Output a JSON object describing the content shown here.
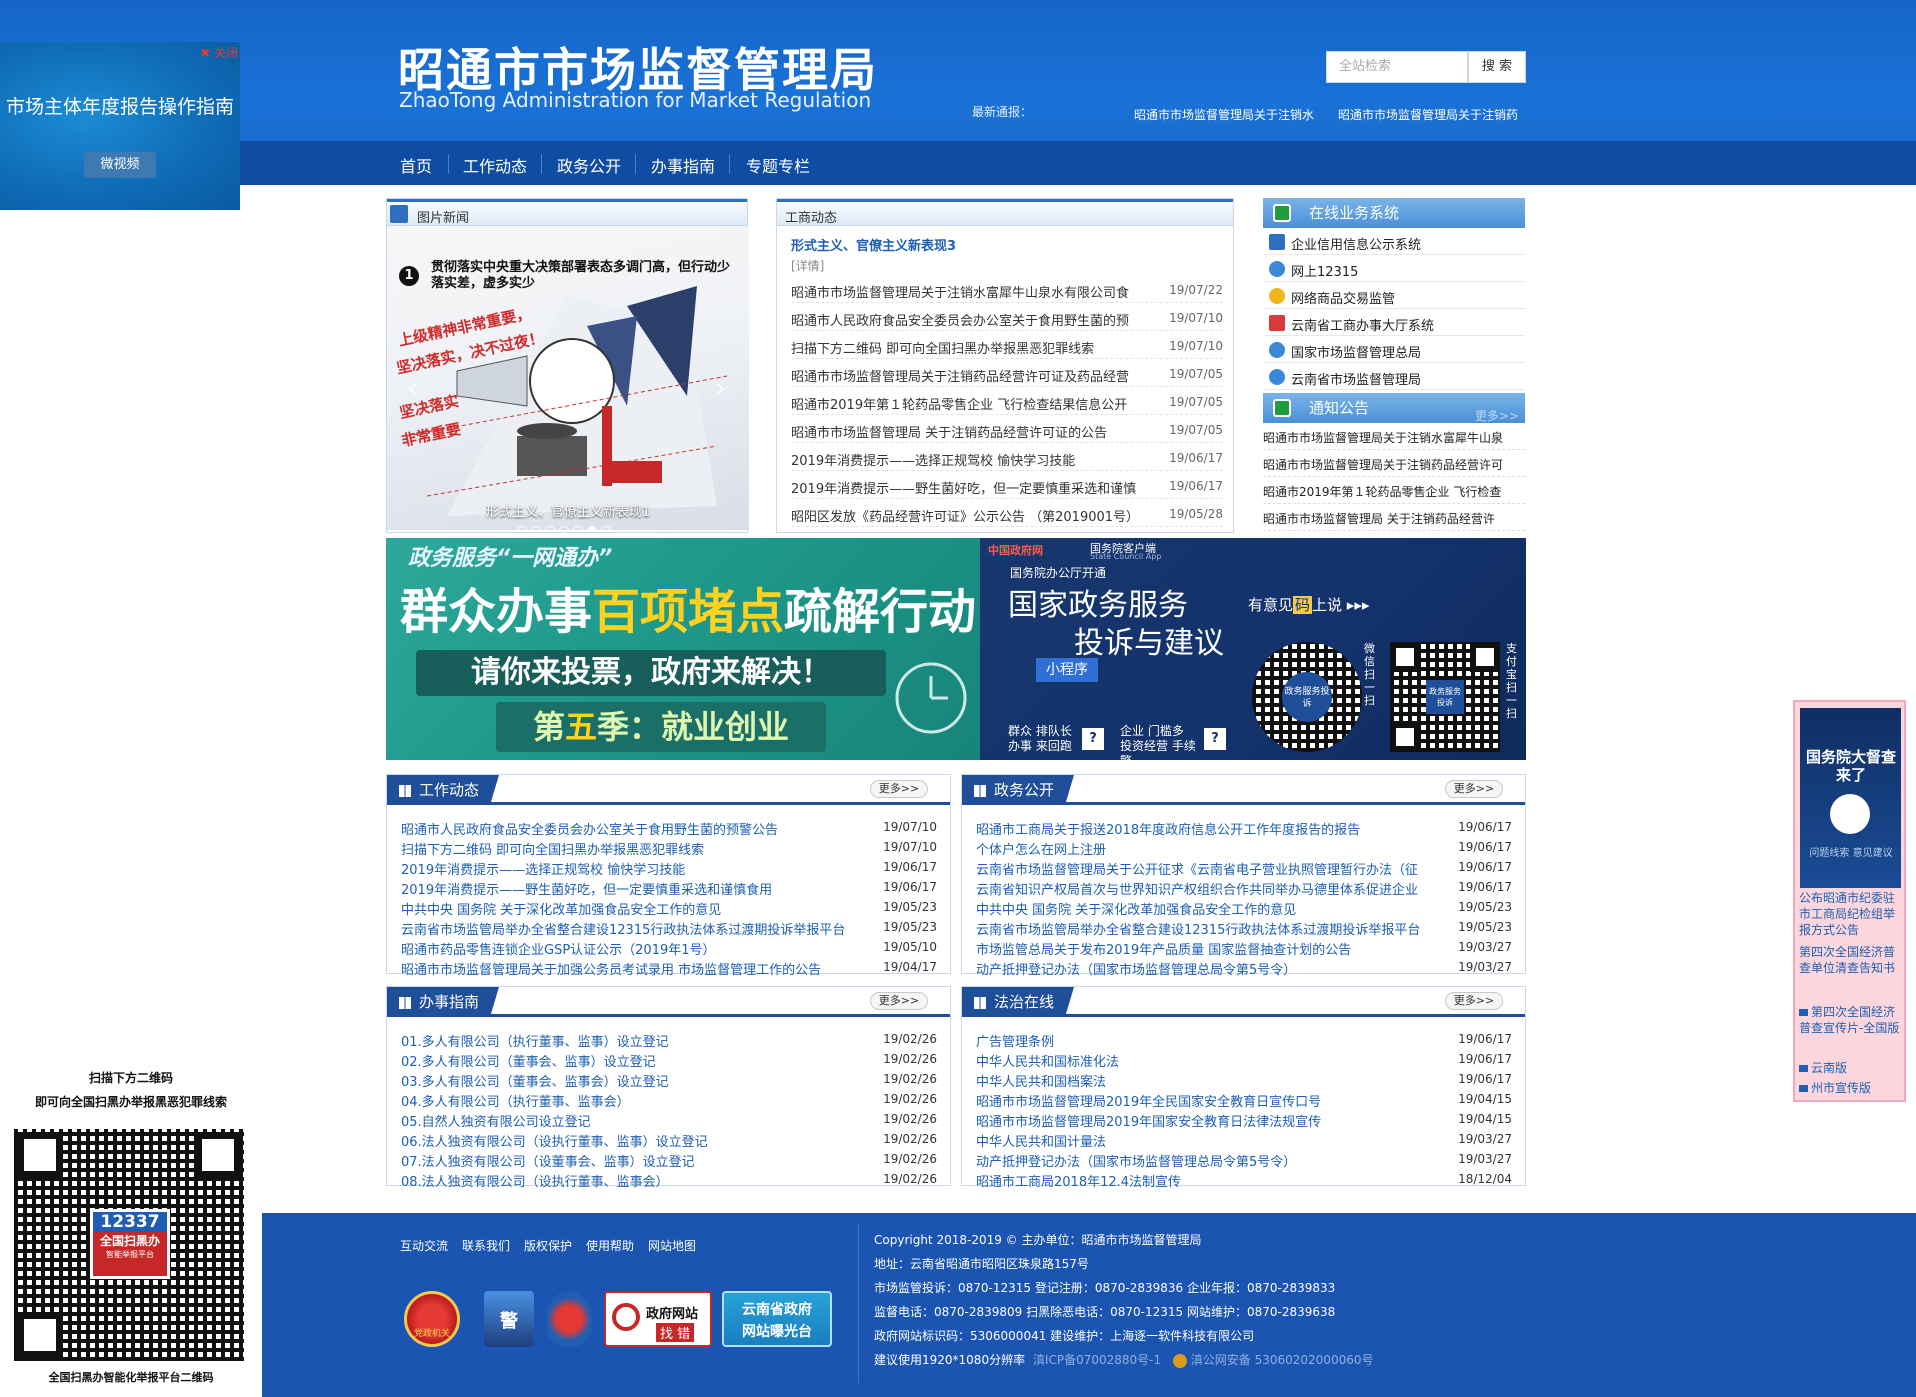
{
  "site": {
    "title": "昭通市市场监督管理局",
    "subtitle": "ZhaoTong Administration for Market Regulation"
  },
  "search": {
    "placeholder": "全站检索",
    "button": "搜 索"
  },
  "ticker": {
    "label": "最新通报：",
    "items": [
      "昭通市市场监督管理局关于注销水",
      "昭通市市场监督管理局关于注销药"
    ]
  },
  "nav": [
    "首页",
    "工作动态",
    "政务公开",
    "办事指南",
    "专题专栏"
  ],
  "float_left": {
    "close": "关闭",
    "title": "市场主体年度报告操作指南",
    "button": "微视频"
  },
  "photo_news": {
    "title": "图片新闻",
    "num": "1",
    "headline": "贯彻落实中央重大决策部署表态多调门高，但行动少落实差，虚多实少",
    "caption": "形式主义、官僚主义新表现1"
  },
  "business_news": {
    "title": "工商动态",
    "featured": "形式主义、官僚主义新表现3",
    "detail": "[详情]",
    "items": [
      {
        "title": "昭通市市场监督管理局关于注销水富犀牛山泉水有限公司食",
        "date": "19/07/22"
      },
      {
        "title": "昭通市人民政府食品安全委员会办公室关于食用野生菌的预",
        "date": "19/07/10"
      },
      {
        "title": "扫描下方二维码 即可向全国扫黑办举报黑恶犯罪线索",
        "date": "19/07/10"
      },
      {
        "title": "昭通市市场监督管理局关于注销药品经营许可证及药品经营",
        "date": "19/07/05"
      },
      {
        "title": "昭通市2019年第１轮药品零售企业 飞行检查结果信息公开",
        "date": "19/07/05"
      },
      {
        "title": "昭通市市场监督管理局 关于注销药品经营许可证的公告",
        "date": "19/07/05"
      },
      {
        "title": "2019年消费提示——选择正规驾校 愉快学习技能",
        "date": "19/06/17"
      },
      {
        "title": "2019年消费提示——野生菌好吃，但一定要慎重采选和谨慎",
        "date": "19/06/17"
      },
      {
        "title": "昭阳区发放《药品经营许可证》公示公告 （第2019001号）",
        "date": "19/05/28"
      }
    ]
  },
  "online_systems": {
    "title": "在线业务系统",
    "items": [
      "企业信用信息公示系统",
      "网上12315",
      "网络商品交易监管",
      "云南省工商办事大厅系统",
      "国家市场监督管理总局",
      "云南省市场监督管理局"
    ]
  },
  "notices": {
    "title": "通知公告",
    "more": "更多>>",
    "items": [
      "昭通市市场监督管理局关于注销水富犀牛山泉",
      "昭通市市场监督管理局关于注销药品经营许可",
      "昭通市2019年第１轮药品零售企业 飞行检查",
      "昭通市市场监督管理局 关于注销药品经营许"
    ]
  },
  "banner_left": {
    "top": "政务服务“一网通办”",
    "main_a": "群众办事",
    "main_b": "百项堵点",
    "main_c": "疏解行动",
    "line2": "请你来投票，政府来解决！",
    "season_a": "第",
    "season_b": "五",
    "season_c": "季：就业创业"
  },
  "banner_right": {
    "brand": "中国政府网",
    "app": "国务院客户端",
    "app_en": "State Council App",
    "open": "国务院办公厅开通",
    "title1": "国家政务服务",
    "title2": "投诉与建议",
    "slogan_a": "有意见",
    "slogan_b": "码",
    "slogan_c": "上说 ▸▸▸",
    "mini": "小程序",
    "line_a": "群众 排队长",
    "line_b": "办事 来回跑",
    "line_c": "企业 门槛多",
    "line_d": "投资经营 手续繁",
    "scan_a": "微信扫一扫",
    "scan_b": "支付宝扫一扫",
    "qr_a": "政务服务投诉",
    "qr_b": "政务服务投诉"
  },
  "work_news": {
    "title": "工作动态",
    "more": "更多>>",
    "items": [
      {
        "title": "昭通市人民政府食品安全委员会办公室关于食用野生菌的预警公告",
        "date": "19/07/10"
      },
      {
        "title": "扫描下方二维码 即可向全国扫黑办举报黑恶犯罪线索",
        "date": "19/07/10"
      },
      {
        "title": "2019年消费提示——选择正规驾校 愉快学习技能",
        "date": "19/06/17"
      },
      {
        "title": "2019年消费提示——野生菌好吃，但一定要慎重采选和谨慎食用",
        "date": "19/06/17"
      },
      {
        "title": "中共中央 国务院 关于深化改革加强食品安全工作的意见",
        "date": "19/05/23"
      },
      {
        "title": "云南省市场监管局举办全省整合建设12315行政执法体系过渡期投诉举报平台",
        "date": "19/05/23"
      },
      {
        "title": "昭通市药品零售连锁企业GSP认证公示（2019年1号）",
        "date": "19/05/10"
      },
      {
        "title": "昭通市市场监督管理局关于加强公务员考试录用 市场监督管理工作的公告",
        "date": "19/04/17"
      }
    ]
  },
  "gov_open": {
    "title": "政务公开",
    "more": "更多>>",
    "items": [
      {
        "title": "昭通市工商局关于报送2018年度政府信息公开工作年度报告的报告",
        "date": "19/06/17"
      },
      {
        "title": "个体户怎么在网上注册",
        "date": "19/06/17"
      },
      {
        "title": "云南省市场监督管理局关于公开征求《云南省电子营业执照管理暂行办法（征",
        "date": "19/06/17"
      },
      {
        "title": "云南省知识产权局首次与世界知识产权组织合作共同举办马德里体系促进企业",
        "date": "19/06/17"
      },
      {
        "title": "中共中央 国务院 关于深化改革加强食品安全工作的意见",
        "date": "19/05/23"
      },
      {
        "title": "云南省市场监管局举办全省整合建设12315行政执法体系过渡期投诉举报平台",
        "date": "19/05/23"
      },
      {
        "title": "市场监管总局关于发布2019年产品质量 国家监督抽查计划的公告",
        "date": "19/03/27"
      },
      {
        "title": "动产抵押登记办法（国家市场监督管理总局令第5号令）",
        "date": "19/03/27"
      }
    ]
  },
  "guide": {
    "title": "办事指南",
    "more": "更多>>",
    "items": [
      {
        "title": "01.多人有限公司（执行董事、监事）设立登记",
        "date": "19/02/26"
      },
      {
        "title": "02.多人有限公司（董事会、监事）设立登记",
        "date": "19/02/26"
      },
      {
        "title": "03.多人有限公司（董事会、监事会）设立登记",
        "date": "19/02/26"
      },
      {
        "title": "04.多人有限公司（执行董事、监事会）",
        "date": "19/02/26"
      },
      {
        "title": "05.自然人独资有限公司设立登记",
        "date": "19/02/26"
      },
      {
        "title": "06.法人独资有限公司（设执行董事、监事）设立登记",
        "date": "19/02/26"
      },
      {
        "title": "07.法人独资有限公司（设董事会、监事）设立登记",
        "date": "19/02/26"
      },
      {
        "title": "08.法人独资有限公司（设执行董事、监事会）",
        "date": "19/02/26"
      }
    ]
  },
  "law": {
    "title": "法治在线",
    "more": "更多>>",
    "items": [
      {
        "title": "广告管理条例",
        "date": "19/06/17"
      },
      {
        "title": "中华人民共和国标准化法",
        "date": "19/06/17"
      },
      {
        "title": "中华人民共和国档案法",
        "date": "19/06/17"
      },
      {
        "title": "昭通市市场监督管理局2019年全民国家安全教育日宣传口号",
        "date": "19/04/15"
      },
      {
        "title": "昭通市市场监督管理局2019年国家安全教育日法律法规宣传",
        "date": "19/04/15"
      },
      {
        "title": "中华人民共和国计量法",
        "date": "19/03/27"
      },
      {
        "title": "动产抵押登记办法（国家市场监督管理总局令第5号令）",
        "date": "19/03/27"
      },
      {
        "title": "昭通市工商局2018年12.4法制宣传",
        "date": "18/12/04"
      }
    ]
  },
  "footer": {
    "links": [
      "互动交流",
      "联系我们",
      "版权保护",
      "使用帮助",
      "网站地图"
    ],
    "lines": [
      "Copyright 2018-2019 © 主办单位：昭通市市场监督管理局",
      "地址：云南省昭通市昭阳区珠泉路157号",
      "市场监管投诉：0870-12315 登记注册：0870-2839836 企业年报：0870-2839833",
      "监督电话：0870-2839809 扫黑除恶电话：0870-12315 网站维护：0870-2839638",
      "政府网站标识码：5306000041 建设维护：上海逐一软件科技有限公司",
      "建议使用1920*1080分辨率"
    ],
    "icp": "滇ICP备07002880号-1",
    "police": "滇公网安备 53060202000060号",
    "badges": {
      "party": "党政机关",
      "police_badge": "警",
      "gov_find_a": "政府网站",
      "gov_find_b": "找 错",
      "yn_a": "云南省政府",
      "yn_b": "网站曝光台"
    }
  },
  "qr_left": {
    "line1": "扫描下方二维码",
    "line2": "即可向全国扫黑办举报黑恶犯罪线索",
    "badge_num": "12337",
    "badge_text": "全国扫黑办",
    "badge_sub": "智能举报平台",
    "caption": "全国扫黑办智能化举报平台二维码"
  },
  "float_right": {
    "img_title": "国务院大督查来了",
    "img_sub": "问题线索 意见建议",
    "links": [
      "公布昭通市纪委驻市工商局纪检组举报方式公告",
      "第四次全国经济普查单位清查告知书",
      "第四次全国经济普查宣传片-全国版",
      "云南版",
      "州市宣传版"
    ]
  },
  "colors": {
    "header_blue": "#1a6fd4",
    "nav_blue": "#0f4da3",
    "footer_blue": "#1b55b1",
    "section_blue": "#1f4f99",
    "link_blue": "#1e5fb3"
  }
}
